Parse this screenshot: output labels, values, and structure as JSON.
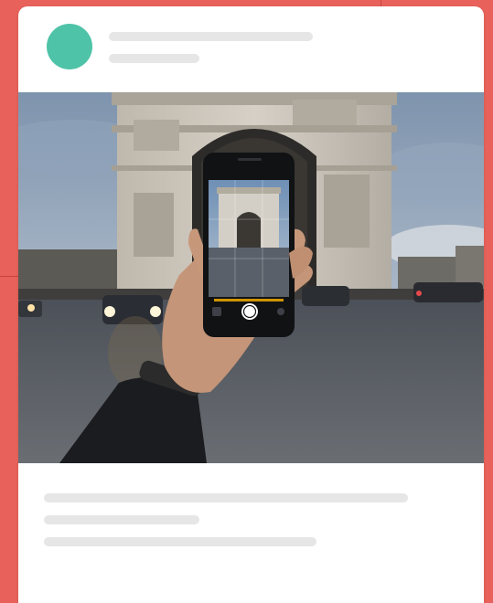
{
  "colors": {
    "background": "#e8625b",
    "card": "#ffffff",
    "avatar": "#4fc3a7",
    "skeleton": "#e6e6e6"
  },
  "post": {
    "avatar_icon": "user-avatar-icon",
    "photo_icon": "arc-de-triomphe-phone-photo"
  }
}
